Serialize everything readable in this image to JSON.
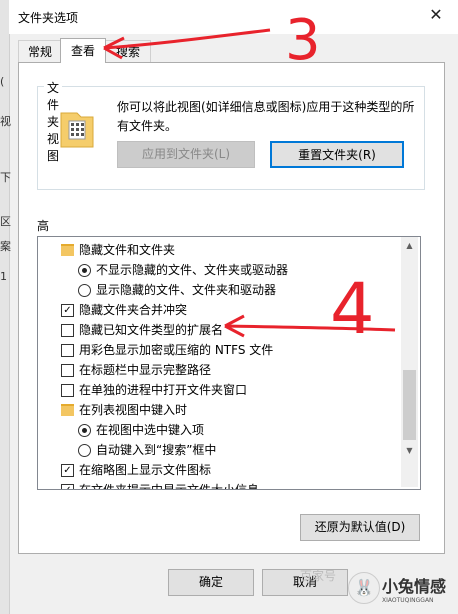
{
  "window": {
    "title": "文件夹选项",
    "close_glyph": "✕"
  },
  "left_strip": [
    "(",
    "视",
    "下",
    "区",
    "案",
    "1"
  ],
  "tabs": [
    {
      "label": "常规"
    },
    {
      "label": "查看"
    },
    {
      "label": "搜索"
    }
  ],
  "folder_views": {
    "group_title": "文件夹视图",
    "description": "你可以将此视图(如详细信息或图标)应用于这种类型的所有文件夹。",
    "apply_button": "应用到文件夹(L)",
    "reset_button": "重置文件夹(R)"
  },
  "advanced": {
    "label": "高级设置:",
    "items": [
      {
        "type": "folder",
        "label": "隐藏文件和文件夹"
      },
      {
        "type": "radio",
        "checked": true,
        "label": "不显示隐藏的文件、文件夹或驱动器"
      },
      {
        "type": "radio",
        "checked": false,
        "label": "显示隐藏的文件、文件夹和驱动器"
      },
      {
        "type": "checkbox",
        "checked": true,
        "label": "隐藏文件夹合并冲突"
      },
      {
        "type": "checkbox",
        "checked": false,
        "label": "隐藏已知文件类型的扩展名"
      },
      {
        "type": "checkbox",
        "checked": false,
        "label": "用彩色显示加密或压缩的 NTFS 文件"
      },
      {
        "type": "checkbox",
        "checked": false,
        "label": "在标题栏中显示完整路径"
      },
      {
        "type": "checkbox",
        "checked": false,
        "label": "在单独的进程中打开文件夹窗口"
      },
      {
        "type": "folder",
        "label": "在列表视图中键入时"
      },
      {
        "type": "radio",
        "checked": true,
        "label": "在视图中选中键入项"
      },
      {
        "type": "radio",
        "checked": false,
        "label": "自动键入到“搜索”框中"
      },
      {
        "type": "checkbox",
        "checked": true,
        "label": "在缩略图上显示文件图标"
      },
      {
        "type": "checkbox",
        "checked": true,
        "label": "在文件夹提示中显示文件大小信息"
      }
    ],
    "restore_button": "还原为默认值(D)"
  },
  "footer": {
    "ok": "确定",
    "cancel": "取消"
  },
  "annotations": {
    "three": "3",
    "four": "4"
  },
  "watermark": {
    "text": "百家号",
    "logo_title": "小兔情感",
    "logo_sub": "XIAOTUQINGGAN"
  },
  "colors": {
    "accent": "#0078d7",
    "annotation_red": "#e8232c"
  }
}
